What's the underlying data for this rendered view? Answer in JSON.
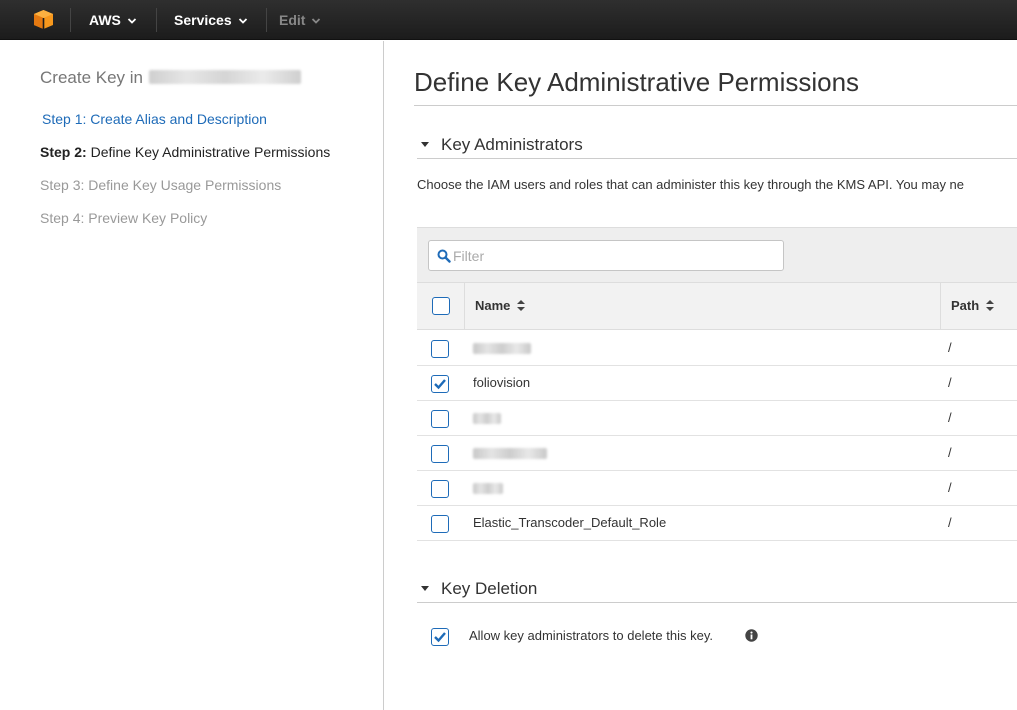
{
  "topbar": {
    "brand_label": "AWS",
    "services_label": "Services",
    "edit_label": "Edit"
  },
  "sidebar": {
    "title_prefix": "Create Key in",
    "steps": [
      {
        "label": "Step 1: Create Alias and Description",
        "state": "link"
      },
      {
        "prefix": "Step 2:",
        "label": " Define Key Administrative Permissions",
        "state": "current"
      },
      {
        "label": "Step 3: Define Key Usage Permissions",
        "state": "future"
      },
      {
        "label": "Step 4: Preview Key Policy",
        "state": "future"
      }
    ]
  },
  "main": {
    "page_title": "Define Key Administrative Permissions",
    "admins_section": {
      "title": "Key Administrators",
      "description": "Choose the IAM users and roles that can administer this key through the KMS API. You may ne",
      "filter_placeholder": "Filter",
      "columns": {
        "name": "Name",
        "path": "Path"
      },
      "rows": [
        {
          "name": "",
          "path": "/",
          "checked": false,
          "redacted": true
        },
        {
          "name": "foliovision",
          "path": "/",
          "checked": true,
          "redacted": false
        },
        {
          "name": "",
          "path": "/",
          "checked": false,
          "redacted": true
        },
        {
          "name": "",
          "path": "/",
          "checked": false,
          "redacted": true
        },
        {
          "name": "",
          "path": "/",
          "checked": false,
          "redacted": true
        },
        {
          "name": "Elastic_Transcoder_Default_Role",
          "path": "/",
          "checked": false,
          "redacted": false
        }
      ]
    },
    "deletion_section": {
      "title": "Key Deletion",
      "allow_label": "Allow key administrators to delete this key.",
      "allow_checked": true
    }
  },
  "colors": {
    "accent": "#1e6bb8",
    "aws_orange": "#f90",
    "topbar": "#232323"
  }
}
